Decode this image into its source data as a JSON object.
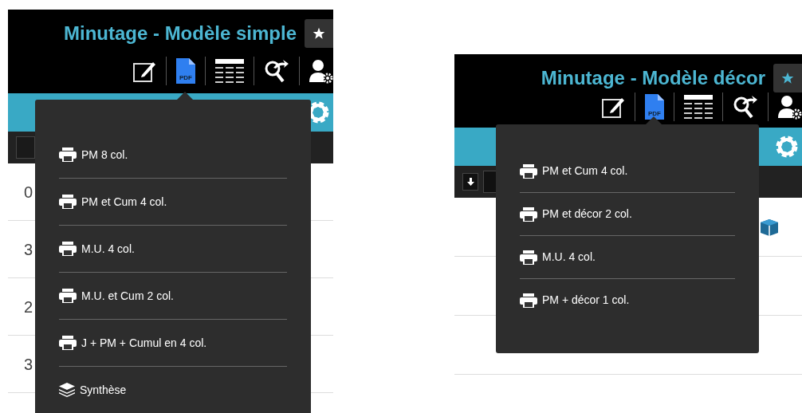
{
  "panels": [
    {
      "title": "Minutage - Modèle simple",
      "pdf_icon_label": "PDF",
      "menu": {
        "items": [
          {
            "kind": "print",
            "label": "PM 8 col."
          },
          {
            "kind": "print",
            "label": "PM et Cum 4 col."
          },
          {
            "kind": "print",
            "label": "M.U. 4 col."
          },
          {
            "kind": "print",
            "label": "M.U. et Cum 2 col."
          },
          {
            "kind": "print",
            "label": "J + PM + Cumul en 4 col."
          },
          {
            "kind": "layers",
            "label": "Synthèse"
          }
        ]
      },
      "rows": [
        {
          "column_1": "0"
        },
        {
          "column_1": "3"
        },
        {
          "column_1": "2"
        },
        {
          "column_1": "3"
        }
      ]
    },
    {
      "title": "Minutage - Modèle décor",
      "pdf_icon_label": "PDF",
      "menu": {
        "items": [
          {
            "kind": "print",
            "label": "PM et Cum 4 col."
          },
          {
            "kind": "print",
            "label": "PM et décor 2 col."
          },
          {
            "kind": "print",
            "label": "M.U. 4 col."
          },
          {
            "kind": "print",
            "label": "PM + décor 1 col."
          }
        ]
      },
      "rows": [
        {
          "kind": "package"
        },
        {
          "kind": "empty"
        },
        {
          "kind": "empty"
        }
      ]
    }
  ]
}
